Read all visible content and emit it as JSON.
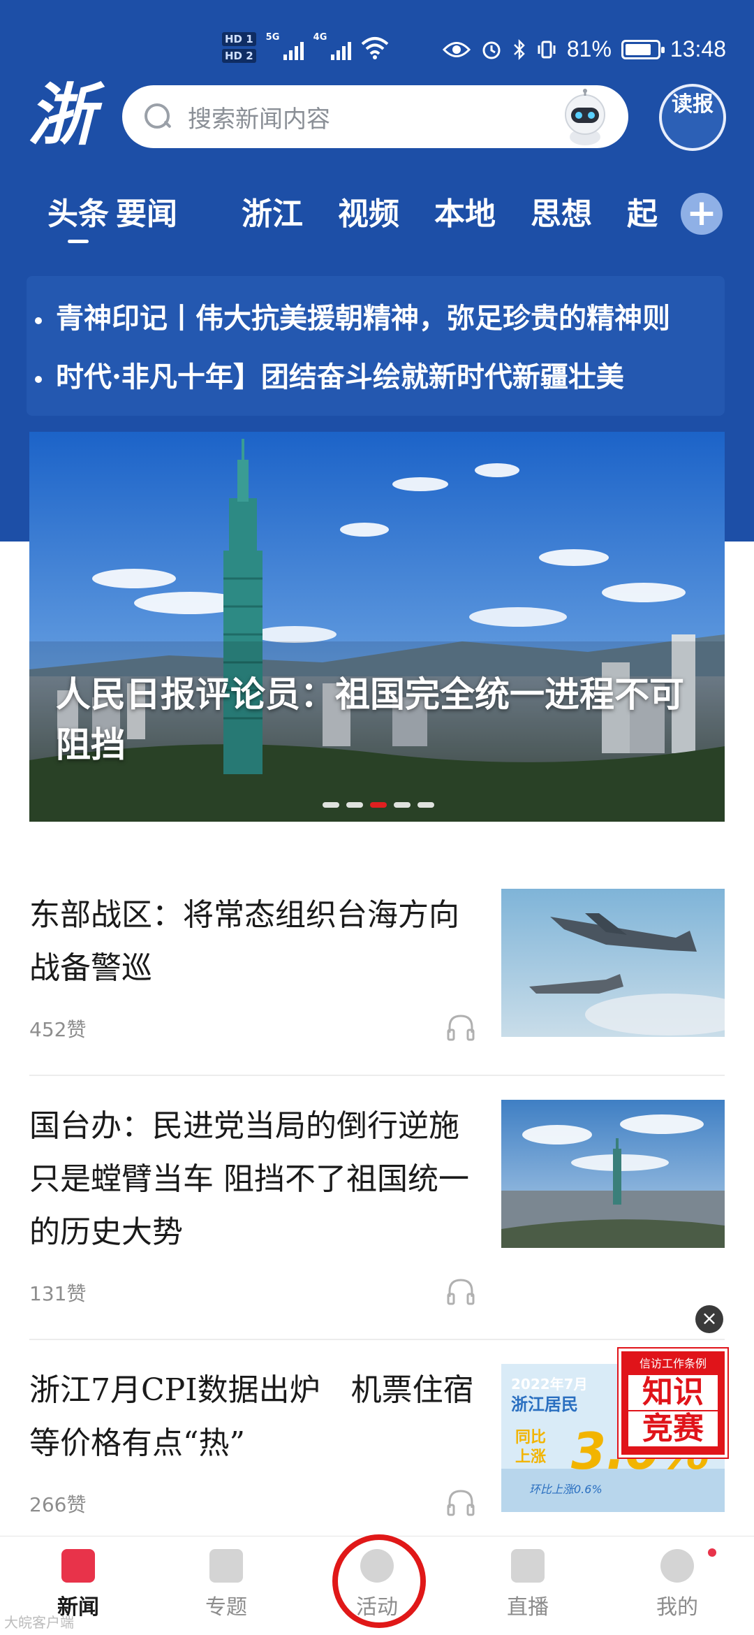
{
  "status_bar": {
    "hd1": "HD 1",
    "hd2": "HD 2",
    "net1": "5G",
    "net2": "4G",
    "battery": "81%",
    "battery_level": 0.81,
    "time": "13:48"
  },
  "header": {
    "logo": "浙",
    "search_placeholder": "搜索新闻内容",
    "dubao_label": "读报"
  },
  "tabs": [
    {
      "label": "头条",
      "active": true
    },
    {
      "label": "要闻"
    },
    {
      "label": "浙江"
    },
    {
      "label": "视频"
    },
    {
      "label": "本地"
    },
    {
      "label": "思想"
    },
    {
      "label": "起"
    }
  ],
  "tab_add": "+",
  "ticker": [
    "青神印记丨伟大抗美援朝精神，弥足珍贵的精神则",
    "时代·非凡十年】团结奋斗绘就新时代新疆壮美"
  ],
  "banner": {
    "title": "人民日报评论员：祖国完全统一进程不可阻挡",
    "slide_count": 5,
    "active_slide": 3
  },
  "news": [
    {
      "title": "东部战区：将常态组织台海方向战备警巡",
      "likes": "452赞"
    },
    {
      "title": "国台办：民进党当局的倒行逆施只是螳臂当车  阻挡不了祖国统一的历史大势",
      "likes": "131赞"
    },
    {
      "title": "浙江7月CPI数据出炉　机票住宿等价格有点“热”",
      "likes": "266赞"
    }
  ],
  "cpi_thumb": {
    "line1": "2022年7月",
    "line2": "浙江居民",
    "line3": "同比",
    "line4": "上涨",
    "value": "3.0%",
    "line5": "环比上涨0.6%"
  },
  "float_ad": {
    "close": "×",
    "small": "信访工作条例",
    "big1": "知识",
    "big2": "竞赛"
  },
  "bottom_nav": [
    {
      "label": "新闻",
      "active": true
    },
    {
      "label": "专题"
    },
    {
      "label": "活动"
    },
    {
      "label": "直播"
    },
    {
      "label": "我的"
    }
  ],
  "watermark": "大皖客户端"
}
